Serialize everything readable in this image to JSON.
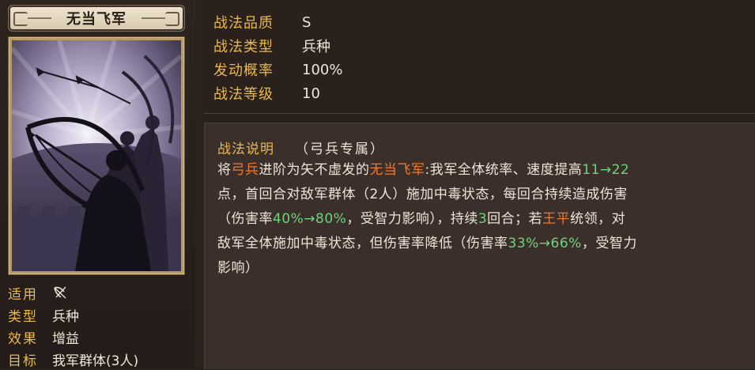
{
  "tactic": {
    "name": "无当飞军"
  },
  "card_attrs": [
    {
      "key": "适用",
      "value": "",
      "icon": "bow-crossed-icon"
    },
    {
      "key": "类型",
      "value": "兵种"
    },
    {
      "key": "效果",
      "value": "增益"
    },
    {
      "key": "目标",
      "value": "我军群体(3人)"
    }
  ],
  "info": [
    {
      "key": "战法品质",
      "value": "S"
    },
    {
      "key": "战法类型",
      "value": "兵种"
    },
    {
      "key": "发动概率",
      "value": "100%"
    },
    {
      "key": "战法等级",
      "value": "10"
    }
  ],
  "description": {
    "heading": "战法说明",
    "tag": "（弓兵专属）",
    "lines": [
      [
        {
          "t": "将",
          "c": ""
        },
        {
          "t": "弓兵",
          "c": "orange"
        },
        {
          "t": "进阶为矢不虚发的",
          "c": ""
        },
        {
          "t": "无当飞军",
          "c": "orange"
        },
        {
          "t": ":我军全体统率、速度提高",
          "c": ""
        },
        {
          "t": "11→22",
          "c": "green"
        }
      ],
      [
        {
          "t": "点，首回合对敌军群体（2人）施加中毒状态，每回合持续造成伤害",
          "c": ""
        }
      ],
      [
        {
          "t": "（伤害率",
          "c": ""
        },
        {
          "t": "40%→80%",
          "c": "green"
        },
        {
          "t": "，受智力影响），持续",
          "c": ""
        },
        {
          "t": "3",
          "c": "green"
        },
        {
          "t": "回合；若",
          "c": ""
        },
        {
          "t": "王平",
          "c": "orange"
        },
        {
          "t": "统领，对",
          "c": ""
        }
      ],
      [
        {
          "t": "敌军全体施加中毒状态，但伤害率降低（伤害率",
          "c": ""
        },
        {
          "t": "33%→66%",
          "c": "green"
        },
        {
          "t": "，受智力",
          "c": ""
        }
      ],
      [
        {
          "t": "影响）",
          "c": ""
        }
      ]
    ]
  },
  "colors": {
    "label_gold": "#e9b94a",
    "highlight_orange": "#f07a2c",
    "highlight_green": "#6fd47c"
  }
}
